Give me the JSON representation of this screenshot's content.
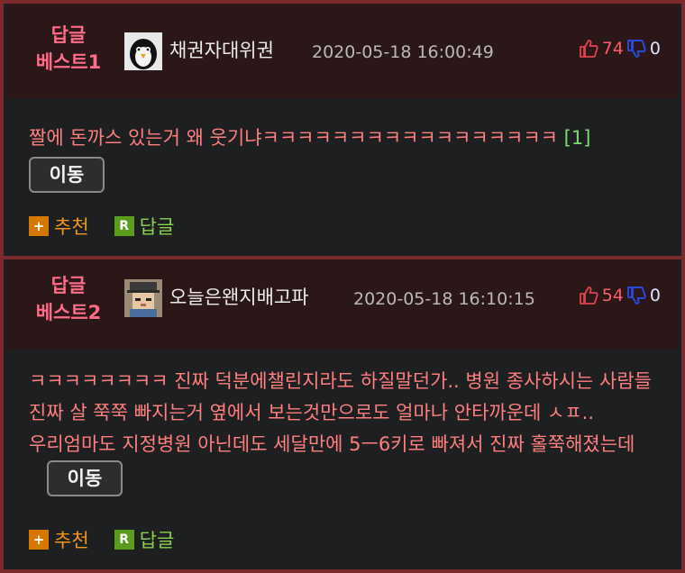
{
  "posts": [
    {
      "best_label_line1": "답글",
      "best_label_line2": "베스트1",
      "nickname": "채권자대위권",
      "date": "2020-05-18 16:00:49",
      "upvotes": "74",
      "downvotes": "0",
      "content": "짤에 돈까스 있는거 왜 웃기냐ㅋㅋㅋㅋㅋㅋㅋㅋㅋㅋㅋㅋㅋㅋㅋㅋㅋ",
      "reference": "[1]",
      "move_label": "이동",
      "recommend_label": "추천",
      "reply_label": "답글",
      "avatar_icon": "penguin-avatar-icon"
    },
    {
      "best_label_line1": "답글",
      "best_label_line2": "베스트2",
      "nickname": "오늘은왠지배고파",
      "date": "2020-05-18 16:10:15",
      "upvotes": "54",
      "downvotes": "0",
      "content": "ㅋㅋㅋㅋㅋㅋㅋㅋ 진짜 덕분에챌린지라도 하질말던가.. 병원 종사하시는 사람들 진짜 살 쭉쭉 빠지는거 옆에서 보는것만으로도 얼마나 안타까운데 ㅅㅍ.. 우리엄마도 지정병원 아닌데도 세달만에 5ㅡ6키로 빠져서 진짜 홀쭉해졌는데",
      "move_label": "이동",
      "recommend_label": "추천",
      "reply_label": "답글",
      "avatar_icon": "pixel-character-avatar-icon"
    }
  ],
  "colors": {
    "best_label": "#ff6c88",
    "content_text": "#ff7e7e",
    "upvote": "#ff5b6b",
    "downvote_icon": "#2a48d8",
    "reference": "#7bdc6b",
    "border": "#7a2a2c"
  },
  "icons": {
    "upvote": "thumbs-up-icon",
    "downvote": "thumbs-down-icon",
    "recommend": "plus-badge-icon",
    "reply": "r-badge-icon"
  }
}
